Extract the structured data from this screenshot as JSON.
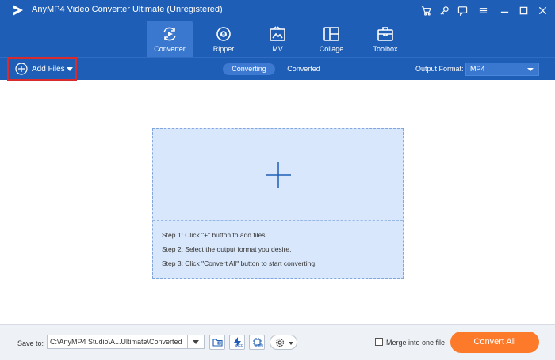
{
  "app": {
    "title": "AnyMP4 Video Converter Ultimate (Unregistered)"
  },
  "nav": {
    "tabs": [
      {
        "label": "Converter",
        "icon": "converter-icon",
        "active": true
      },
      {
        "label": "Ripper",
        "icon": "ripper-icon",
        "active": false
      },
      {
        "label": "MV",
        "icon": "mv-icon",
        "active": false
      },
      {
        "label": "Collage",
        "icon": "collage-icon",
        "active": false
      },
      {
        "label": "Toolbox",
        "icon": "toolbox-icon",
        "active": false
      }
    ]
  },
  "toolbar": {
    "add_files_label": "Add Files",
    "segments": [
      {
        "label": "Converting",
        "active": true
      },
      {
        "label": "Converted",
        "active": false
      }
    ],
    "output_format_label": "Output Format:",
    "output_format_value": "MP4"
  },
  "dropzone": {
    "steps": [
      "Step 1: Click \"+\" button to add files.",
      "Step 2: Select the output format you desire.",
      "Step 3: Click \"Convert All\" button to start converting."
    ]
  },
  "footer": {
    "save_to_label": "Save to:",
    "save_path": "C:\\AnyMP4 Studio\\A...Ultimate\\Converted",
    "hw_accel_off": "OFF",
    "gpu_on": "ON",
    "merge_label": "Merge into one file",
    "merge_checked": false,
    "convert_all_label": "Convert All"
  },
  "colors": {
    "header_blue": "#1e5eb6",
    "active_tab": "#3a77cf",
    "dropzone_fill": "#d8e7fb",
    "convert_orange": "#fe7a2b",
    "highlight_red": "#d92b2b"
  }
}
